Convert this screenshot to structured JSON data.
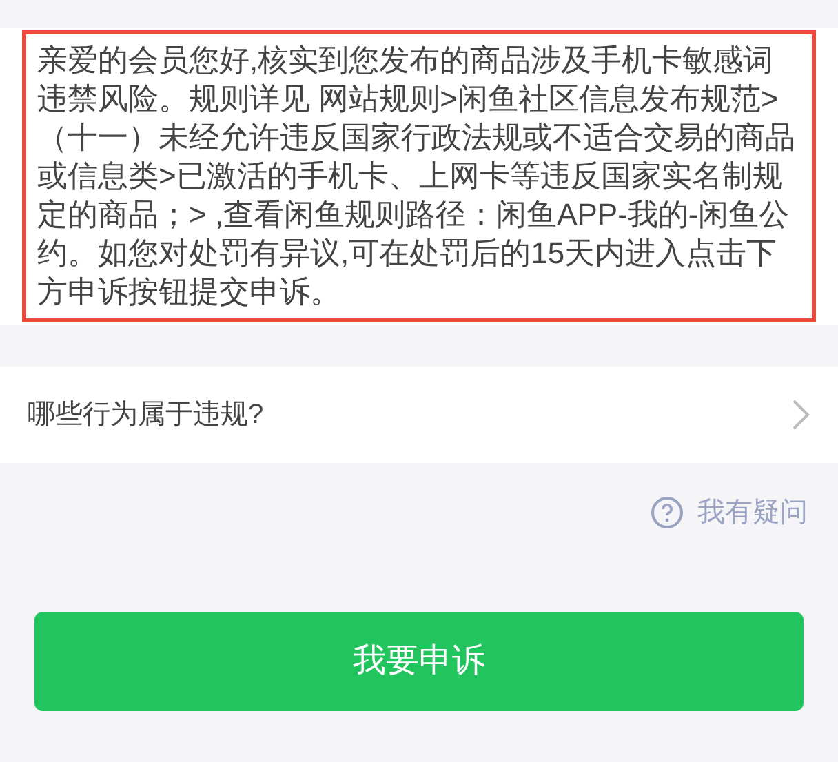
{
  "notice": {
    "text": "亲爱的会员您好,核实到您发布的商品涉及手机卡敏感词违禁风险。规则详见 网站规则>闲鱼社区信息发布规范>（十一）未经允许违反国家行政法规或不适合交易的商品或信息类>已激活的手机卡、上网卡等违反国家实名制规定的商品；> ,查看闲鱼规则路径：闲鱼APP-我的-闲鱼公约。如您对处罚有异议,可在处罚后的15天内进入点击下方申诉按钮提交申诉。"
  },
  "violation_link": {
    "label": "哪些行为属于违规?"
  },
  "question_link": {
    "label": "我有疑问"
  },
  "appeal_button": {
    "label": "我要申诉"
  }
}
